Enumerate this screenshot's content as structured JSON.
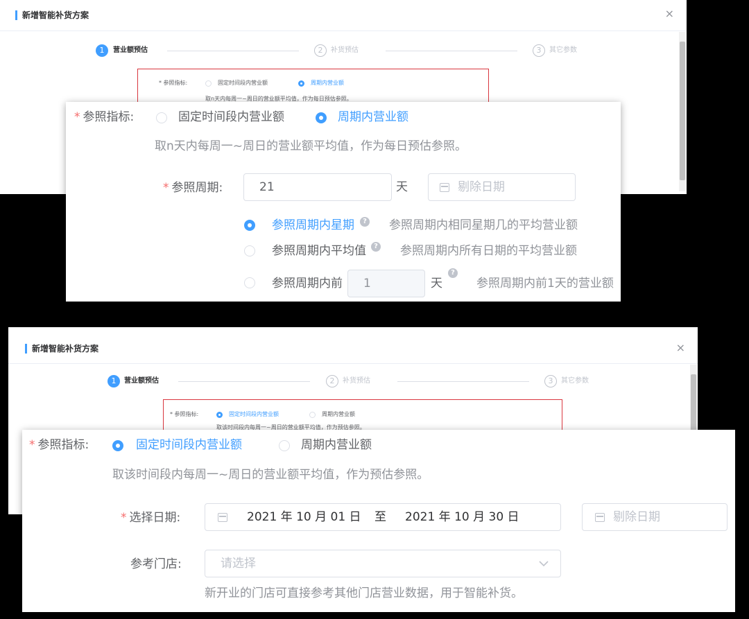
{
  "dialog": {
    "title": "新增智能补货方案",
    "close_glyph": "×",
    "steps": [
      {
        "num": "1",
        "label": "营业额预估"
      },
      {
        "num": "2",
        "label": "补货预估"
      },
      {
        "num": "3",
        "label": "其它参数"
      }
    ]
  },
  "top": {
    "mini": {
      "indicator_label": "* 参照指标:",
      "option1": "固定时间段内营业额",
      "option2": "周期内营业额",
      "desc": "取n天内每周一~周日的营业额平均值，作为每日预估参照。"
    },
    "indicator_label": "参照指标:",
    "option_fixed": "固定时间段内营业额",
    "option_cycle": "周期内营业额",
    "description": "取n天内每周一~周日的营业额平均值，作为每日预估参照。",
    "period_label": "参照周期:",
    "period_value": "21",
    "period_unit": "天",
    "exclude_placeholder": "剔除日期",
    "sub_options": [
      {
        "label": "参照周期内星期",
        "desc": "参照周期内相同星期几的平均营业额",
        "selected": true
      },
      {
        "label": "参照周期内平均值",
        "desc": "参照周期内所有日期的平均营业额",
        "selected": false
      },
      {
        "label": "参照周期内前",
        "value": "1",
        "unit": "天",
        "desc": "参照周期内前1天的营业额",
        "selected": false
      }
    ],
    "help_glyph": "?"
  },
  "bottom": {
    "mini": {
      "indicator_label": "* 参照指标:",
      "option1": "固定时间段内营业额",
      "option2": "周期内营业额",
      "desc": "取该时间段内每周一~周日的营业额平均值，作为预估参照。"
    },
    "indicator_label": "参照指标:",
    "option_fixed": "固定时间段内营业额",
    "option_cycle": "周期内营业额",
    "description": "取该时间段内每周一~周日的营业额平均值，作为预估参照。",
    "date_label": "选择日期:",
    "date_start": "2021 年 10 月 01 日",
    "date_sep": "至",
    "date_end": "2021 年 10 月 30 日",
    "exclude_placeholder": "剔除日期",
    "store_label": "参考门店:",
    "store_placeholder": "请选择",
    "store_hint": "新开业的门店可直接参考其他门店营业数据，用于智能补货。"
  },
  "colors": {
    "primary": "#409eff",
    "required": "#f56c6c",
    "highlight_box": "#d9363e"
  }
}
